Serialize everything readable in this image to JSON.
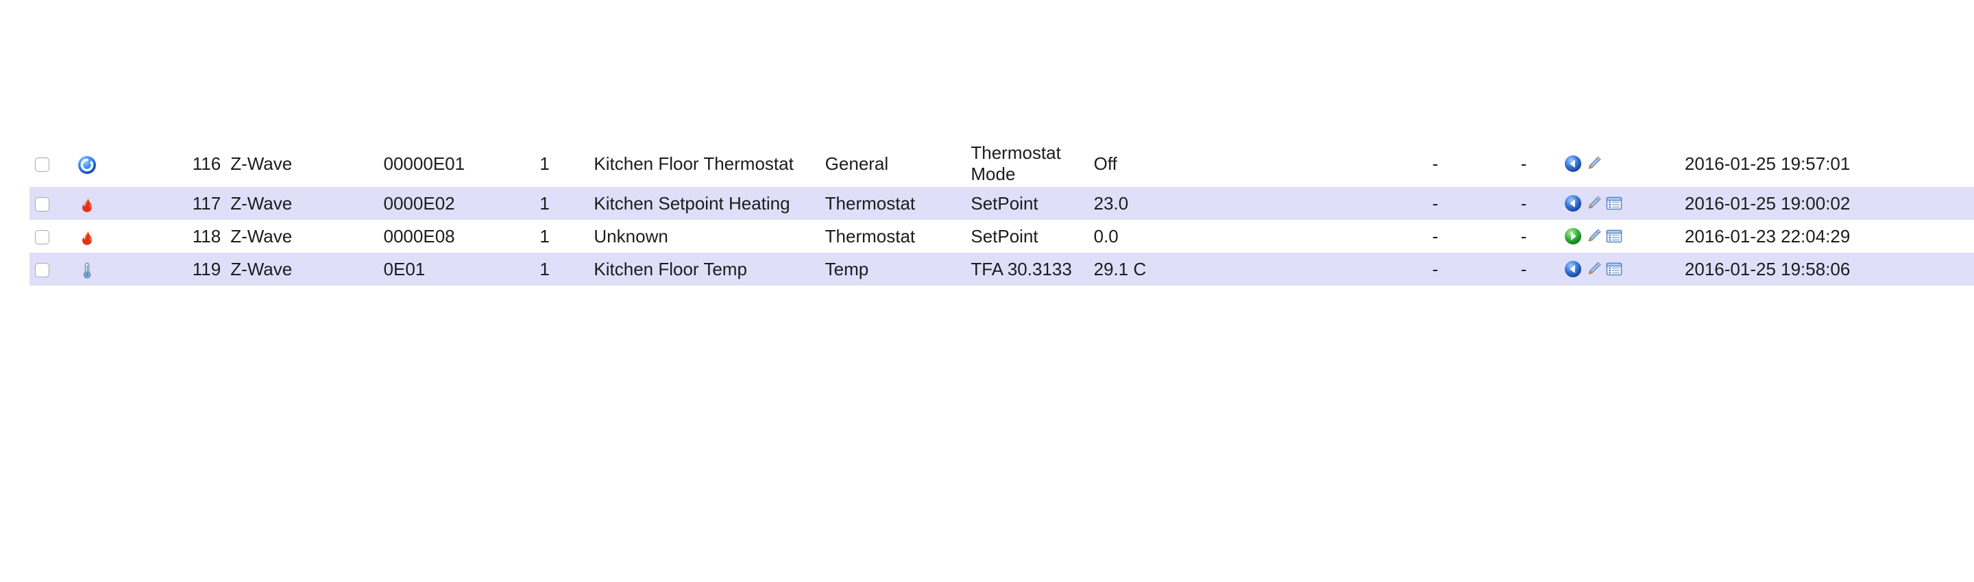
{
  "table": {
    "columns": [
      "select",
      "status-icon",
      "id",
      "protocol",
      "address",
      "instance",
      "name",
      "type",
      "subtype",
      "value",
      "battery",
      "signal",
      "actions",
      "last-update"
    ],
    "rows": [
      {
        "id": "116",
        "protocol": "Z-Wave",
        "address": "00000E01",
        "instance": "1",
        "name": "Kitchen Floor Thermostat",
        "type": "General",
        "subtype": "Thermostat Mode",
        "value": "Off",
        "battery": "-",
        "signal": "-",
        "status_icon": "blue-refresh-icon",
        "actions": [
          "back-arrow-blue-icon",
          "edit-pencil-icon"
        ],
        "timestamp": "2016-01-25 19:57:01",
        "highlighted": false
      },
      {
        "id": "117",
        "protocol": "Z-Wave",
        "address": "0000E02",
        "instance": "1",
        "name": "Kitchen Setpoint Heating",
        "type": "Thermostat",
        "subtype": "SetPoint",
        "value": "23.0",
        "battery": "-",
        "signal": "-",
        "status_icon": "flame-icon",
        "actions": [
          "back-arrow-blue-icon",
          "edit-pencil-icon",
          "log-window-icon"
        ],
        "timestamp": "2016-01-25 19:00:02",
        "highlighted": true
      },
      {
        "id": "118",
        "protocol": "Z-Wave",
        "address": "0000E08",
        "instance": "1",
        "name": "Unknown",
        "type": "Thermostat",
        "subtype": "SetPoint",
        "value": "0.0",
        "battery": "-",
        "signal": "-",
        "status_icon": "flame-icon",
        "actions": [
          "forward-arrow-green-icon",
          "edit-pencil-icon",
          "log-window-icon"
        ],
        "timestamp": "2016-01-23 22:04:29",
        "highlighted": false
      },
      {
        "id": "119",
        "protocol": "Z-Wave",
        "address": "0E01",
        "instance": "1",
        "name": "Kitchen Floor Temp",
        "type": "Temp",
        "subtype": "TFA 30.3133",
        "value": "29.1 C",
        "battery": "-",
        "signal": "-",
        "status_icon": "thermometer-icon",
        "actions": [
          "back-arrow-blue-icon",
          "edit-pencil-icon",
          "log-window-icon"
        ],
        "timestamp": "2016-01-25 19:58:06",
        "highlighted": true
      }
    ]
  },
  "colors": {
    "row_highlight": "#dfdffa",
    "row_plain": "#ffffff",
    "text": "#1c1c1c",
    "icon_blue": "#1a62d6",
    "icon_green": "#22a82a",
    "flame_orange": "#f47a20",
    "flame_red": "#e02a18",
    "checkbox_border": "#a9a9a9"
  }
}
